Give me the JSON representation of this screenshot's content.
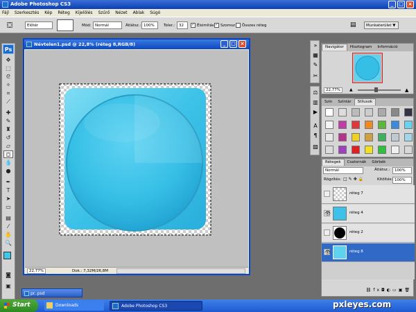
{
  "window": {
    "title": "Adobe Photoshop CS3",
    "buttons": [
      "_",
      "□",
      "×"
    ]
  },
  "menu": [
    "Fájl",
    "Szerkesztés",
    "Kép",
    "Réteg",
    "Kijelölés",
    "Szűrő",
    "Nézet",
    "Ablak",
    "Súgó"
  ],
  "options": {
    "preset": "Előtér",
    "mode_label": "Mód:",
    "mode_value": "Normál",
    "opacity_label": "Átlátsz.:",
    "opacity_value": "100%",
    "tolerance_label": "Toler.:",
    "tolerance_value": "32",
    "antialias_label": "Élsimítás",
    "contiguous_label": "Szomsz",
    "alllayers_label": "Összes réteg",
    "workspace_label": "Munkaterület ▼"
  },
  "document": {
    "title": "Névtelen1.psd @ 22,8% (réteg 8,RGB/8)",
    "zoom": "22,77%",
    "doc_size": "Dok.: 7,32M/26,8M"
  },
  "navigator": {
    "tabs": [
      "Navigátor",
      "Hisztogram",
      "Információ"
    ],
    "zoom": "22,77%"
  },
  "swatches": {
    "tabs": [
      "Szín",
      "Színtár",
      "Stílusok"
    ]
  },
  "layers": {
    "tabs": [
      "Rétegek",
      "Csatornák",
      "Görbék"
    ],
    "blend_mode": "Normál",
    "opacity_label": "Átlátsz.:",
    "opacity_value": "100%",
    "lock_label": "Rögzítés:",
    "fill_label": "Kitöltés:",
    "fill_value": "100%",
    "items": [
      {
        "name": "réteg 7",
        "visible": false,
        "selected": false
      },
      {
        "name": "réteg 4",
        "visible": true,
        "selected": false
      },
      {
        "name": "réteg 2",
        "visible": false,
        "selected": false
      },
      {
        "name": "réteg 8",
        "visible": true,
        "selected": true
      }
    ]
  },
  "minimized_doc": {
    "title": "pr..psd"
  },
  "taskbar": {
    "start": "Start",
    "items": [
      "Downloads",
      "Adobe Photoshop CS3"
    ],
    "watermark": "pxleyes.com"
  },
  "colors": {
    "accent": "#0a46c8",
    "cyan": "#3fc6e8",
    "selected_layer": "#3169c6"
  }
}
